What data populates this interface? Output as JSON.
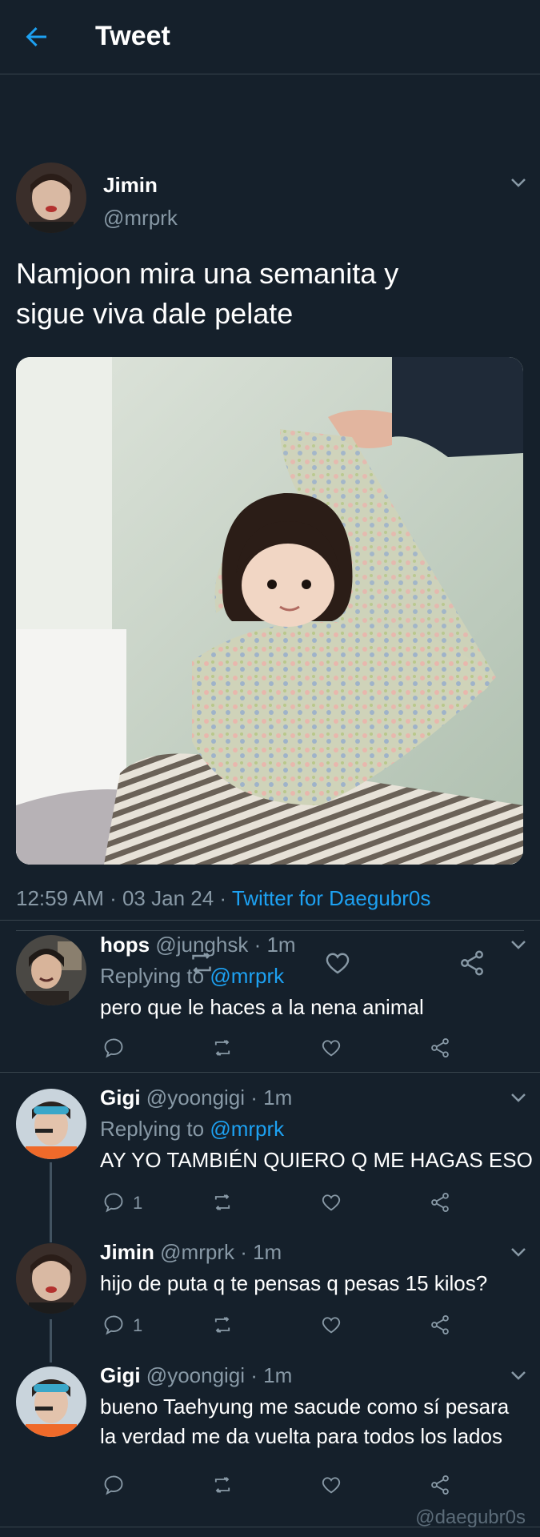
{
  "header": {
    "title": "Tweet",
    "back_icon": "arrow-left-icon",
    "accent": "#1da1f2"
  },
  "tweet": {
    "author_name": "Jimin",
    "author_handle": "@mrprk",
    "text_line1": "Namjoon mira una semanita y",
    "text_line2": "sigue viva dale pelate",
    "time": "12:59 AM",
    "date": "03 Jan 24",
    "client": "Twitter for Daegubr0s",
    "dot": " · "
  },
  "replies": [
    {
      "name": "hops",
      "handle": "@junghsk",
      "time": "1m",
      "replying_prefix": "Replying to ",
      "replying_to": "@mrprk",
      "text": "pero que le haces a la nena animal",
      "reply_count": ""
    },
    {
      "name": "Gigi",
      "handle": "@yoongigi",
      "time": "1m",
      "replying_prefix": "Replying to ",
      "replying_to": "@mrprk",
      "text": "AY YO TAMBIÉN QUIERO Q ME HAGAS ESO",
      "reply_count": "1"
    },
    {
      "name": "Jimin",
      "handle": "@mrprk",
      "time": "1m",
      "text": "hijo de puta q te pensas q pesas 15 kilos?",
      "reply_count": "1"
    },
    {
      "name": "Gigi",
      "handle": "@yoongigi",
      "time": "1m",
      "text_line1": "bueno Taehyung me sacude como sí pesara",
      "text_line2": "la verdad me da vuelta para todos los lados",
      "reply_count": ""
    }
  ],
  "watermark": "@daegubr0s",
  "colors": {
    "background": "#15202b",
    "secondary_text": "#8899a6",
    "divider": "#38444d",
    "link": "#1da1f2"
  }
}
